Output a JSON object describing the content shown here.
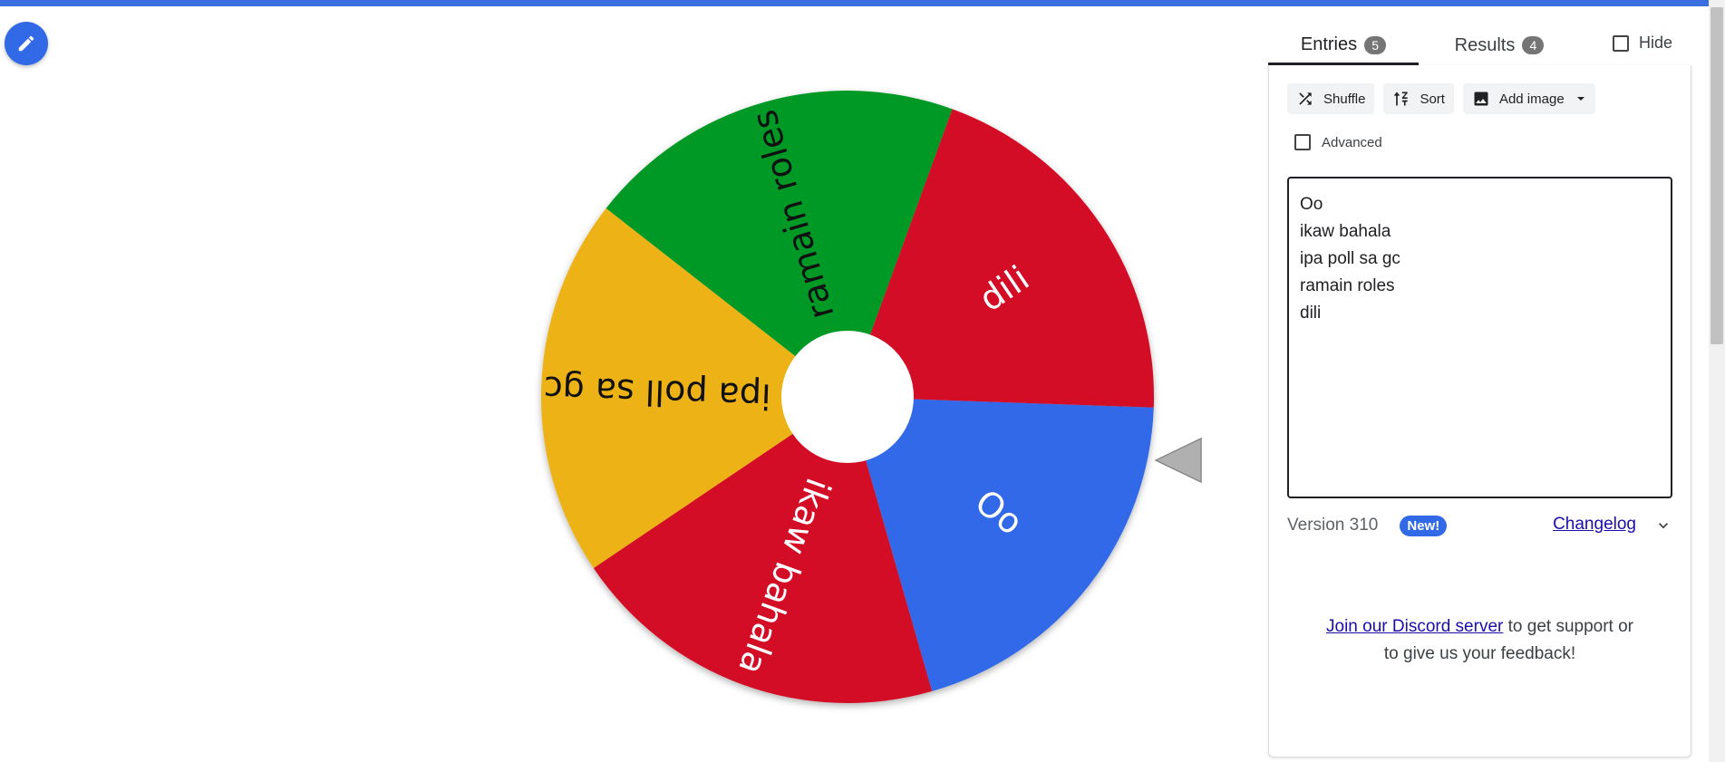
{
  "colors": {
    "accent": "#3269e6",
    "red": "#d41027",
    "yellow": "#edb313",
    "green": "#009926",
    "blue": "#3369e8"
  },
  "toolbar": {
    "edit_icon": "pencil-icon"
  },
  "wheel": {
    "segments": [
      {
        "label": "Oo",
        "color": "#3369e8"
      },
      {
        "label": "ikaw bahala",
        "color": "#d41027"
      },
      {
        "label": "ipa poll sa gc",
        "color": "#edb313"
      },
      {
        "label": "ramain roles",
        "color": "#009926"
      },
      {
        "label": "dili",
        "color": "#d41027"
      }
    ],
    "pointer_icon": "triangle-pointer-icon"
  },
  "tabs": {
    "entries": {
      "label": "Entries",
      "count": "5"
    },
    "results": {
      "label": "Results",
      "count": "4"
    },
    "hide_label": "Hide"
  },
  "panel": {
    "shuffle_label": "Shuffle",
    "sort_label": "Sort",
    "add_image_label": "Add image",
    "advanced_label": "Advanced",
    "entries": [
      "Oo",
      "ikaw bahala",
      "ipa poll sa gc",
      "ramain roles",
      "dili"
    ],
    "version_text": "Version 310",
    "new_badge": "New!",
    "changelog_label": "Changelog",
    "discord_link": "Join our Discord server",
    "discord_text": " to get support or to give us your feedback!"
  }
}
